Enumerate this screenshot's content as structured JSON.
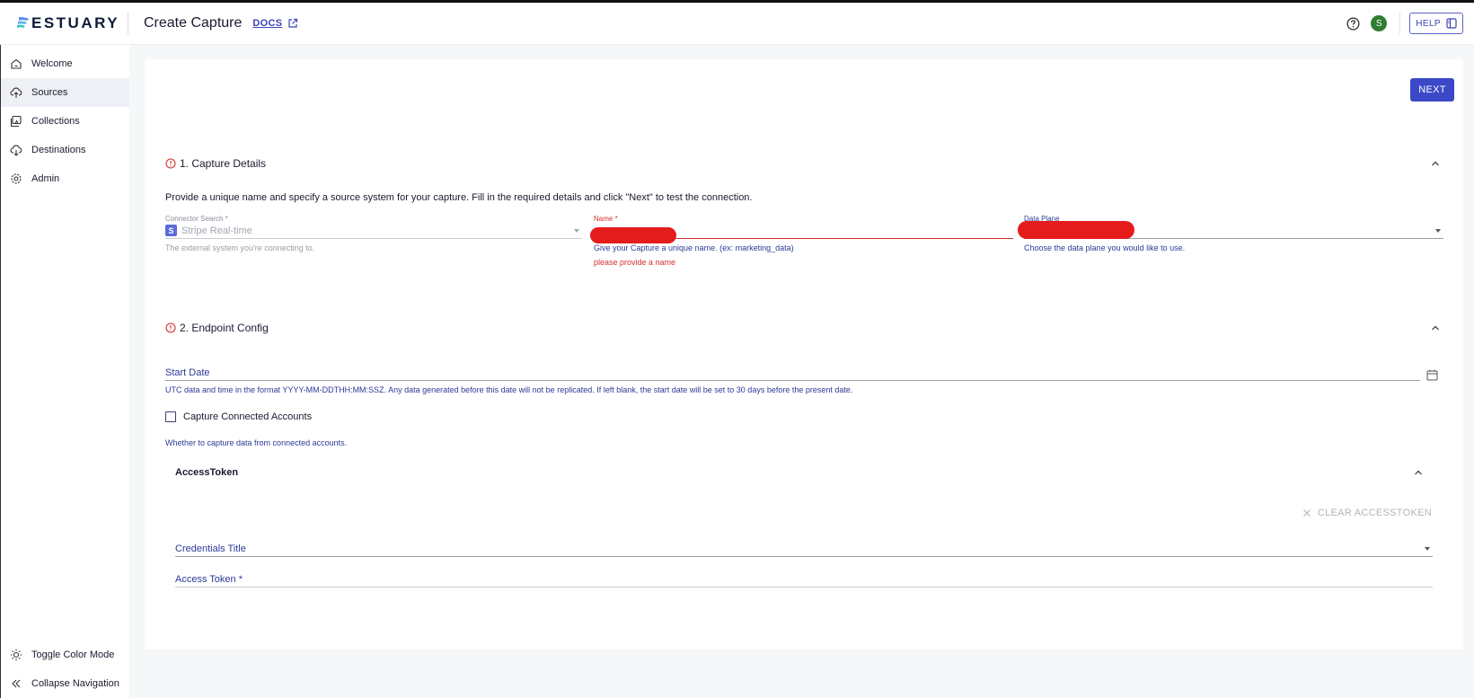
{
  "brand": {
    "name": "ESTUARY"
  },
  "header": {
    "title": "Create Capture",
    "docs_label": "DOCS",
    "avatar_initial": "S",
    "help_label": "HELP"
  },
  "sidebar": {
    "items": [
      {
        "label": "Welcome",
        "icon": "home-icon"
      },
      {
        "label": "Sources",
        "icon": "cloud-upload-icon",
        "active": true
      },
      {
        "label": "Collections",
        "icon": "collections-icon"
      },
      {
        "label": "Destinations",
        "icon": "cloud-download-icon"
      },
      {
        "label": "Admin",
        "icon": "gear-icon"
      }
    ],
    "bottom": [
      {
        "label": "Toggle Color Mode",
        "icon": "sun-icon"
      },
      {
        "label": "Collapse Navigation",
        "icon": "double-chevron-left-icon"
      }
    ]
  },
  "actions": {
    "next_label": "NEXT"
  },
  "capture_details": {
    "title": "1. Capture Details",
    "description": "Provide a unique name and specify a source system for your capture. Fill in the required details and click \"Next\" to test the connection.",
    "connector": {
      "label": "Connector Search *",
      "value": "Stripe Real-time",
      "badge": "S",
      "helper": "The external system you're connecting to."
    },
    "name": {
      "label": "Name *",
      "helper": "Give your Capture a unique name. (ex: marketing_data)",
      "error": "please provide a name"
    },
    "data_plane": {
      "label": "Data Plane",
      "helper": "Choose the data plane you would like to use."
    }
  },
  "endpoint_config": {
    "title": "2. Endpoint Config",
    "start_date": {
      "label": "Start Date",
      "helper": "UTC data and time in the format YYYY-MM-DDTHH:MM:SSZ. Any data generated before this date will not be replicated. If left blank, the start date will be set to 30 days before the present date."
    },
    "connected_accounts": {
      "label": "Capture Connected Accounts",
      "helper": "Whether to capture data from connected accounts."
    },
    "access_token_section": {
      "title": "AccessToken",
      "clear_label": "CLEAR ACCESSTOKEN",
      "credentials_title_label": "Credentials Title",
      "access_token_label": "Access Token *"
    }
  },
  "colors": {
    "accent": "#3b49c9",
    "error": "#d32f2f",
    "link": "#2c3a96"
  }
}
